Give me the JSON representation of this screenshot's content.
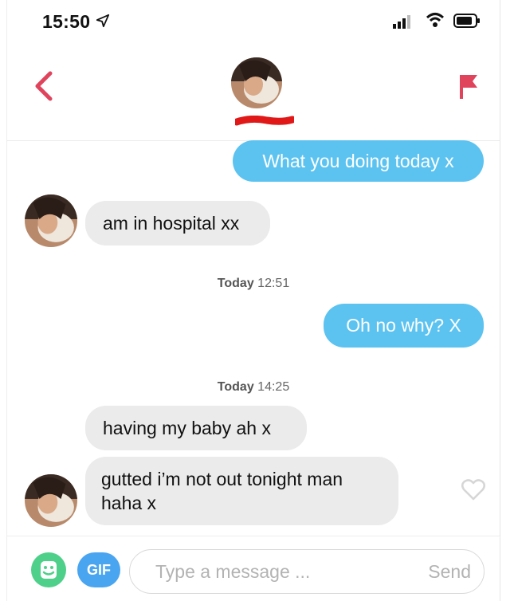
{
  "status": {
    "time": "15:50"
  },
  "header": {
    "contact_avatar": "avatar-image",
    "back_icon": "chevron-left-icon",
    "report_icon": "flag-icon"
  },
  "messages": [
    {
      "from": "me",
      "text": "What you doing today x"
    },
    {
      "from": "them",
      "text": "am in hospital xx"
    },
    {
      "type": "timestamp",
      "day": "Today",
      "time": "12:51"
    },
    {
      "from": "me",
      "text": "Oh no why? X"
    },
    {
      "type": "timestamp",
      "day": "Today",
      "time": "14:25"
    },
    {
      "from": "them",
      "text": "having my baby ah x"
    },
    {
      "from": "them",
      "text": "gutted i’m not out tonight man haha x"
    }
  ],
  "composer": {
    "gif_label": "GIF",
    "placeholder": "Type a message ...",
    "send_label": "Send"
  },
  "colors": {
    "outgoing": "#5cc3f1",
    "incoming": "#ebebeb",
    "accent": "#e0435c",
    "sticker": "#4fd08a",
    "gif": "#4aa5f0"
  }
}
